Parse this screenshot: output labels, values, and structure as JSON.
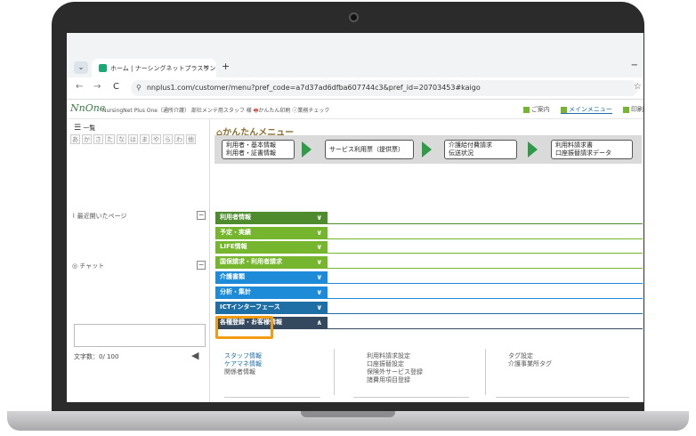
{
  "browser": {
    "tab_title": "ホーム | ナーシングネットプラスワン",
    "tab_close": "×",
    "new_tab": "+",
    "minimize": "−",
    "back": "←",
    "forward": "→",
    "reload": "C",
    "url": "nnplus1.com/customer/menu?pref_code=a7d37ad6dfba607744c3&pref_id=20703453#kaigo",
    "bookmark": "☆"
  },
  "appbar": {
    "logo": "NnOne",
    "brand": "NursingNet Plus One（通所介護）",
    "office": "部社メンテ用スタッフ 様",
    "print": "かんたん印刷",
    "check": "業務チェック",
    "nav": [
      "ご案内",
      "メインメニュー",
      "印刷"
    ]
  },
  "sidebar": {
    "list_label": "一覧",
    "kana": [
      "あ",
      "か",
      "さ",
      "た",
      "な",
      "は",
      "ま",
      "や",
      "ら",
      "わ",
      "他"
    ],
    "recent_label": "最近開いたページ",
    "chat_label": "チャット",
    "box_symbol": "−",
    "char_count": "文字数：0/ 100",
    "send": "◀"
  },
  "content": {
    "easy_title": "かんたんメニュー",
    "easy_boxes": [
      {
        "line1": "利用者・基本情報",
        "line2": "利用者・証書情報"
      },
      {
        "line1": "サービス利用票（提供票）",
        "line2": ""
      },
      {
        "line1": "介護給付費請求",
        "line2": "伝送状況"
      },
      {
        "line1": "利用料請求書",
        "line2": "口座振替請求データ"
      }
    ],
    "menus": [
      {
        "label": "利用者情報",
        "color": "#4e8a2e"
      },
      {
        "label": "予定・実績",
        "color": "#76b52e"
      },
      {
        "label": "LIFE情報",
        "color": "#76b52e"
      },
      {
        "label": "国保請求・利用者請求",
        "color": "#76b52e"
      },
      {
        "label": "介護書類",
        "color": "#1d8bd8"
      },
      {
        "label": "分析・集計",
        "color": "#1d8bd8"
      },
      {
        "label": "ICTインターフェース",
        "color": "#1d6fa5"
      },
      {
        "label": "各種登録・お客様情報",
        "color": "#34495e"
      }
    ],
    "chev_down": "∨",
    "chev_up": "∧",
    "col1": [
      "スタッフ情報",
      "ケアマネ情報",
      "関係者情報"
    ],
    "col2": [
      "利用料請求設定",
      "口座振替設定",
      "保険外サービス登録",
      "諸費用項目登録"
    ],
    "col3": [
      "タグ設定",
      "介護事業所タグ"
    ]
  }
}
